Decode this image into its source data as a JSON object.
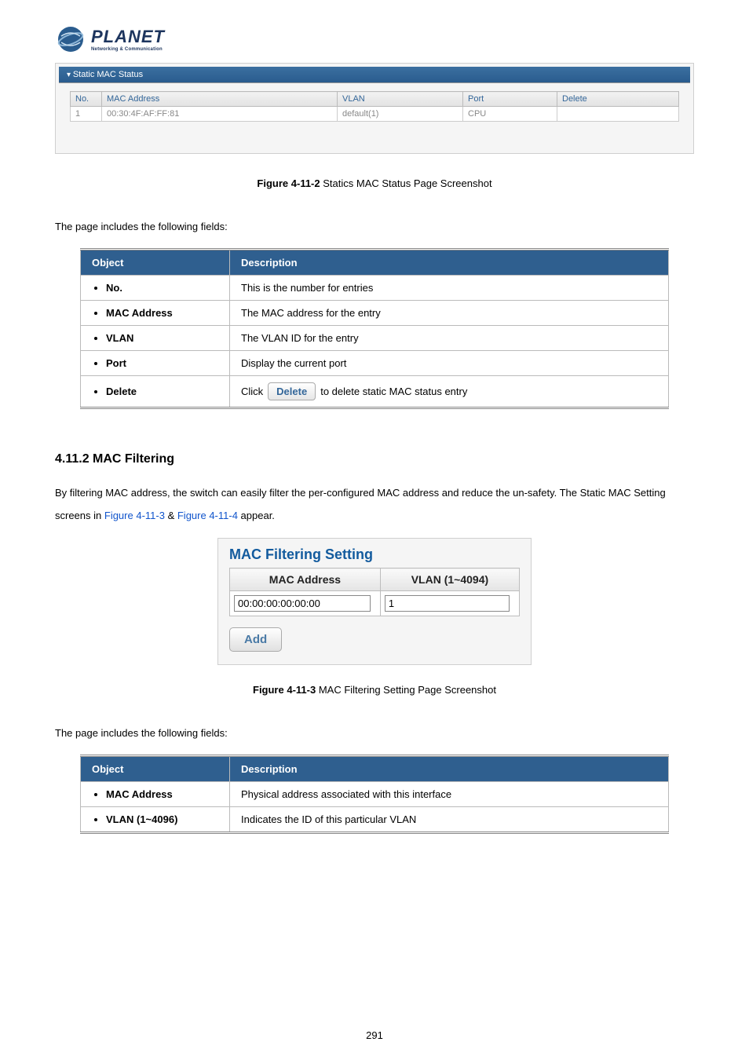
{
  "logo": {
    "brand": "PLANET",
    "tagline": "Networking & Communication"
  },
  "status_panel": {
    "header": "Static MAC Status",
    "columns": {
      "no": "No.",
      "mac": "MAC Address",
      "vlan": "VLAN",
      "port": "Port",
      "delete": "Delete"
    },
    "rows": [
      {
        "no": "1",
        "mac": "00:30:4F:AF:FF:81",
        "vlan": "default(1)",
        "port": "CPU",
        "delete": ""
      }
    ]
  },
  "caption1": {
    "label": "Figure 4-11-2",
    "text": " Statics MAC Status Page Screenshot"
  },
  "fields_intro": "The page includes the following fields:",
  "table1": {
    "head_obj": "Object",
    "head_desc": "Description",
    "rows": [
      {
        "obj": "No.",
        "desc": "This is the number for entries"
      },
      {
        "obj": "MAC Address",
        "desc": "The MAC address for the entry"
      },
      {
        "obj": "VLAN",
        "desc": "The VLAN ID for the entry"
      },
      {
        "obj": "Port",
        "desc": "Display the current port"
      }
    ],
    "delete_row": {
      "obj": "Delete",
      "pre": "Click",
      "btn": "Delete",
      "post": " to delete static MAC status entry"
    }
  },
  "section2": {
    "title": "4.11.2 MAC Filtering",
    "para_a": "By filtering MAC address, the switch can easily filter the per-configured MAC address and reduce the un-safety. The Static MAC Setting screens in ",
    "link1": "Figure 4-11-3",
    "amp": " & ",
    "link2": "Figure 4-11-4",
    "para_b": " appear."
  },
  "filter_panel": {
    "title": "MAC Filtering Setting",
    "col_mac": "MAC Address",
    "col_vlan": "VLAN (1~4094)",
    "val_mac": "00:00:00:00:00:00",
    "val_vlan": "1",
    "add": "Add"
  },
  "caption2": {
    "label": "Figure 4-11-3",
    "text": " MAC Filtering Setting Page Screenshot"
  },
  "table2": {
    "head_obj": "Object",
    "head_desc": "Description",
    "rows": [
      {
        "obj": "MAC Address",
        "desc": "Physical address associated with this interface"
      },
      {
        "obj": "VLAN (1~4096)",
        "desc": "Indicates the ID of this particular VLAN"
      }
    ]
  },
  "page_number": "291"
}
